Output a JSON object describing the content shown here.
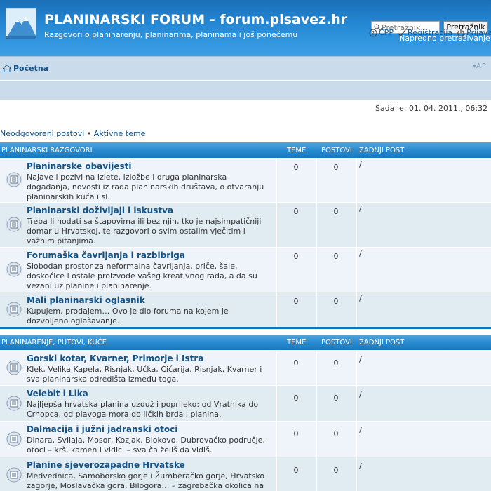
{
  "header": {
    "title": "PLANINARSKI FORUM - forum.plsavez.hr",
    "description": "Razgovori o planinarenju, planinarima, planinama i još ponečemu",
    "search_placeholder": "Pretražnik…",
    "search_button": "Pretražnik",
    "advanced_search": "Napredno pretraživanje"
  },
  "navbar": {
    "home": "Početna",
    "font_size": "▾A^",
    "links": [
      {
        "label": "ČPP",
        "icon": "help-icon"
      },
      {
        "label": "Registracija",
        "icon": "register-icon"
      },
      {
        "label": "Prijava",
        "icon": "power-icon"
      }
    ]
  },
  "date_text": "Sada je: 01. 04. 2011., 06:32",
  "quicklinks": [
    "Neodgovoreni postovi",
    "Aktivne teme"
  ],
  "quicklinks_sep": " • ",
  "columns": {
    "topics": "TEME",
    "posts": "POSTOVI",
    "last_post": "ZADNJI POST"
  },
  "categories": [
    {
      "name": "PLANINARSKI RAZGOVORI",
      "forums": [
        {
          "name": "Planinarske obavijesti",
          "desc": "Najave i pozivi na izlete, izložbe i druga planinarska događanja, novosti iz rada planinarskih društava, o otvaranju planinarskih kuća i sl.",
          "topics": "0",
          "posts": "0",
          "last": "/"
        },
        {
          "name": "Planinarski doživljaji i iskustva",
          "desc": "Treba li hodati sa štapovima ili bez njih, tko je najsimpatičniji domar u Hrvatskoj, te razgovori o svim ostalim vječitim i važnim pitanjima.",
          "topics": "0",
          "posts": "0",
          "last": "/"
        },
        {
          "name": "Forumaška čavrljanja i razbibriga",
          "desc": "Slobodan prostor za neformalna čavrljanja, priče, šale, doskočice i ostale proizvode vašeg kreativnog rada, a da su vezani uz planine i planinarenje.",
          "topics": "0",
          "posts": "0",
          "last": "/"
        },
        {
          "name": "Mali planinarski oglasnik",
          "desc": "Kupujem, prodajem… Ovo je dio foruma na kojem je dozvoljeno oglašavanje.",
          "topics": "0",
          "posts": "0",
          "last": "/"
        }
      ]
    },
    {
      "name": "PLANINARENJE, PUTOVI, KUĆE",
      "forums": [
        {
          "name": "Gorski kotar, Kvarner, Primorje i Istra",
          "desc": "Klek, Velika Kapela, Risnjak, Učka, Ćićarija, Risnjak, Kvarner i sva planinarska odredišta između toga.",
          "topics": "0",
          "posts": "0",
          "last": "/"
        },
        {
          "name": "Velebit i Lika",
          "desc": "Najljepša hrvatska planina uzduž i poprijeko: od Vratnika do Crnopca, od plavoga mora do ličkih brda i planina.",
          "topics": "0",
          "posts": "0",
          "last": "/"
        },
        {
          "name": "Dalmacija i južni jadranski otoci",
          "desc": "Dinara, Svilaja, Mosor, Kozjak, Biokovo, Dubrovačko područje, otoci – krš, kamen i vidici – sva ča želiš da vidiš.",
          "topics": "0",
          "posts": "0",
          "last": "/"
        },
        {
          "name": "Planine sjeverozapadne Hrvatske",
          "desc": "Medvednica, Samoborsko gorje i Žumberačko gorje, Hrvatsko zagorje, Moslavačka gora, Bilogora… – zagrebačka okolica na",
          "topics": "0",
          "posts": "0",
          "last": "/"
        }
      ]
    }
  ]
}
